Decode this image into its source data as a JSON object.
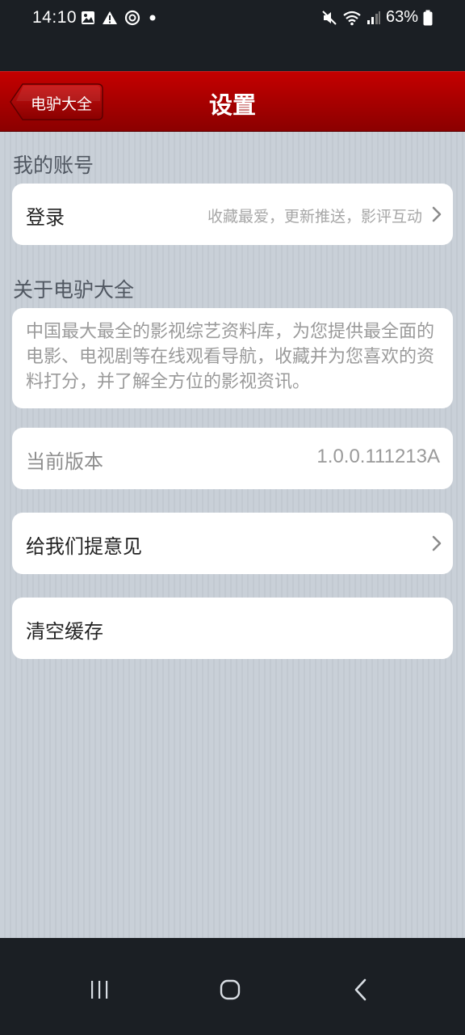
{
  "status_bar": {
    "time": "14:10",
    "battery": "63%",
    "left_icons": [
      "image-icon",
      "warning-icon",
      "sync-icon",
      "dot-icon"
    ],
    "right_icons": [
      "mute-icon",
      "wifi-icon",
      "signal-icon",
      "battery-icon"
    ]
  },
  "header": {
    "back_label": "电驴大全",
    "title": "设置",
    "color": "#b00000"
  },
  "account": {
    "section_title": "我的账号",
    "login_label": "登录",
    "login_hint": "收藏最爱，更新推送，影评互动"
  },
  "about": {
    "section_title": "关于电驴大全",
    "description": "中国最大最全的影视综艺资料库，为您提供最全面的电影、电视剧等在线观看导航，收藏并为您喜欢的资料打分，并了解全方位的影视资讯。",
    "version_label": "当前版本",
    "version_value": "1.0.0.111213A"
  },
  "feedback": {
    "label": "给我们提意见"
  },
  "cache": {
    "label": "清空缓存"
  },
  "nav_bar": {
    "buttons": [
      "recent-apps-icon",
      "home-icon",
      "back-icon"
    ]
  }
}
